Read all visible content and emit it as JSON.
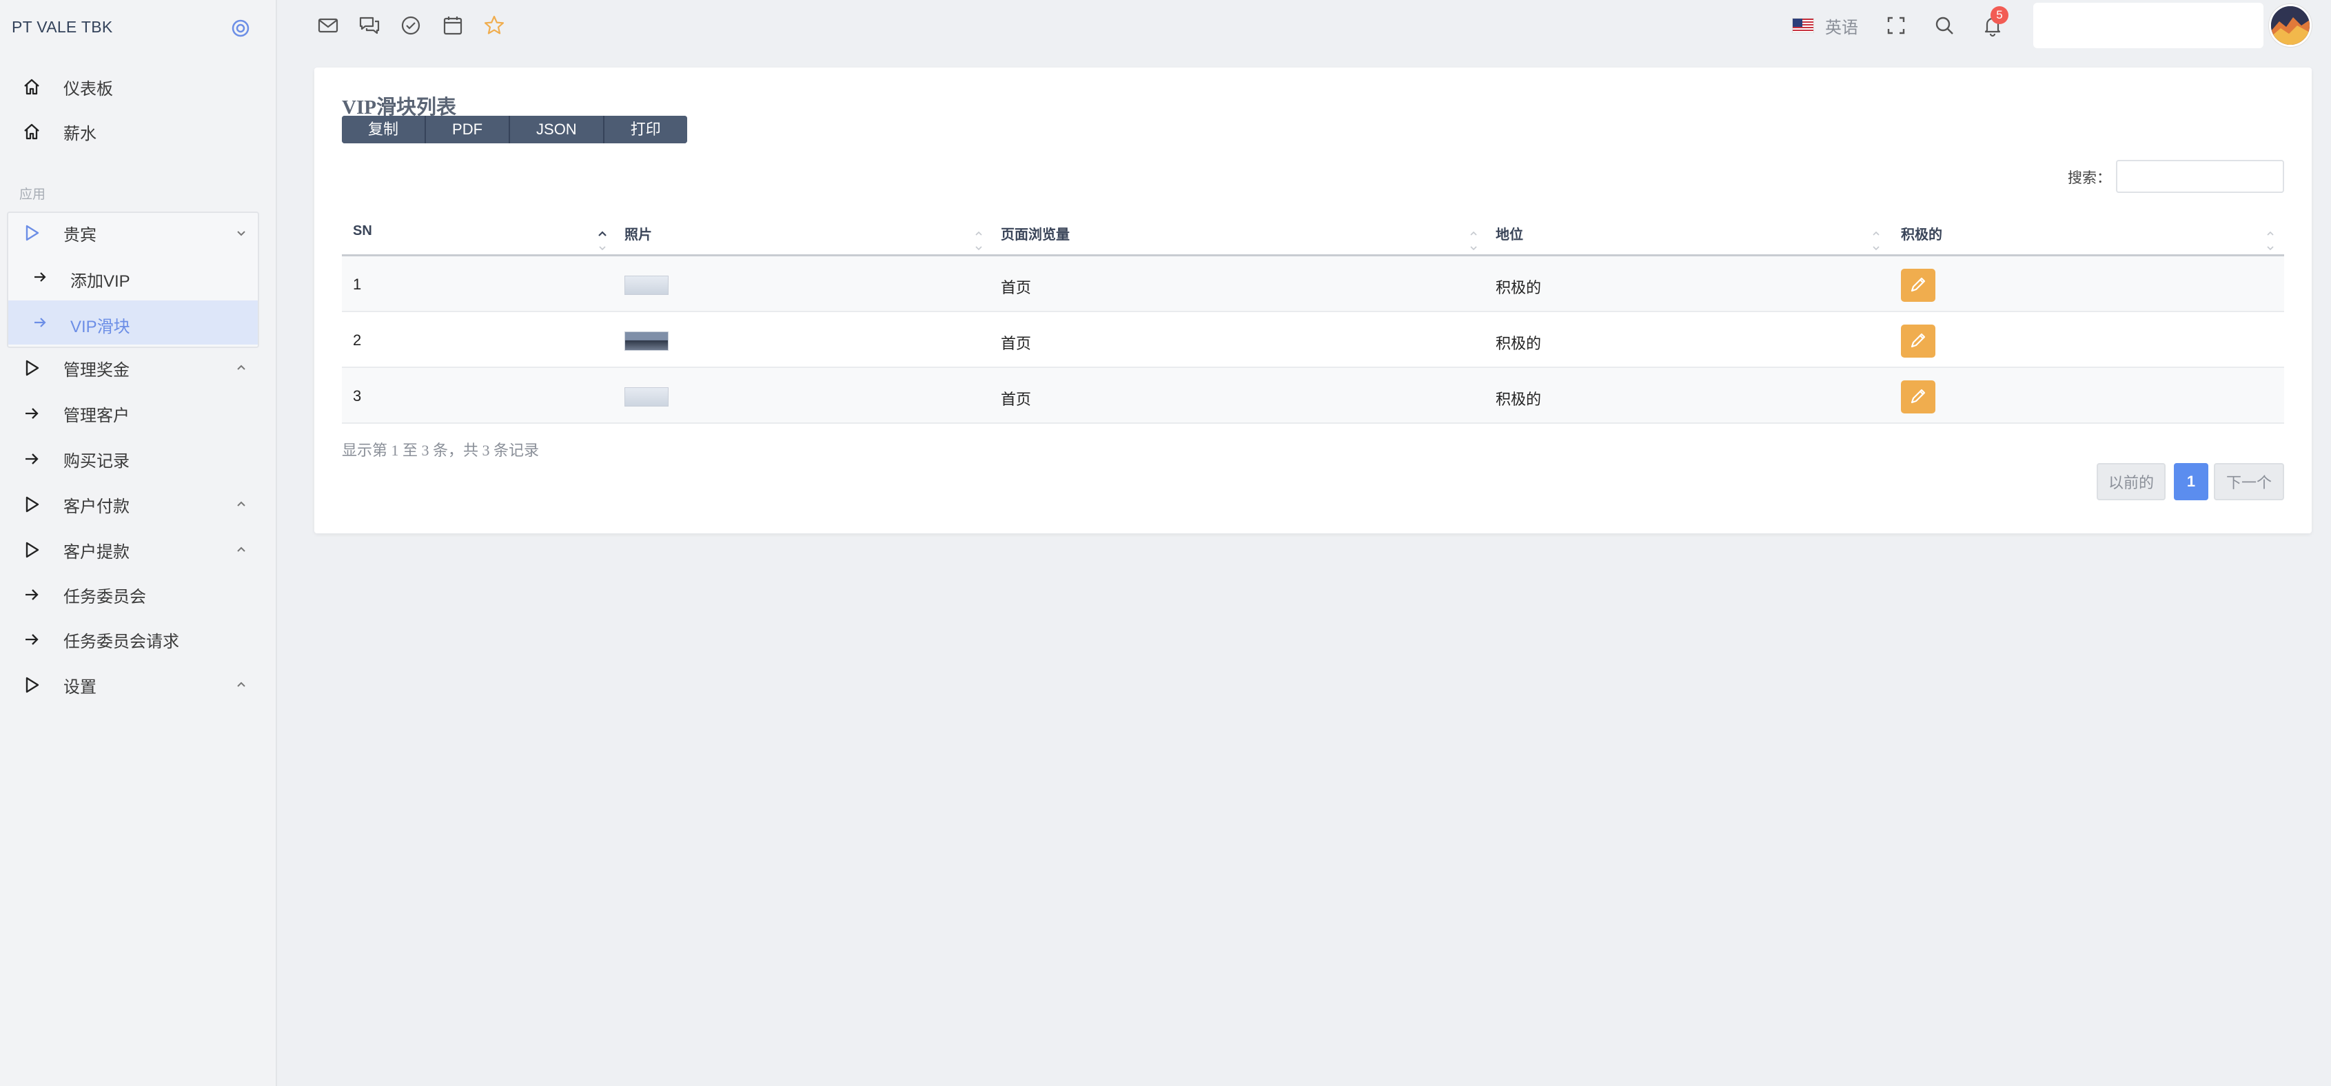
{
  "sidebar": {
    "brand": "PT VALE TBK",
    "top_items": [
      {
        "label": "仪表板",
        "icon": "home-icon"
      },
      {
        "label": "薪水",
        "icon": "home-icon"
      }
    ],
    "section_label": "应用",
    "items": [
      {
        "label": "贵宾",
        "icon": "play-icon",
        "caret": "chevron-down-icon"
      },
      {
        "label": "添加VIP",
        "icon": "arrow-right-icon"
      },
      {
        "label": "VIP滑块",
        "icon": "arrow-right-icon",
        "active": true
      },
      {
        "label": "管理奖金",
        "icon": "play-icon",
        "caret": "chevron-up-icon"
      },
      {
        "label": "管理客户",
        "icon": "arrow-right-icon"
      },
      {
        "label": "购买记录",
        "icon": "arrow-right-icon"
      },
      {
        "label": "客户付款",
        "icon": "play-icon",
        "caret": "chevron-up-icon"
      },
      {
        "label": "客户提款",
        "icon": "play-icon",
        "caret": "chevron-up-icon"
      },
      {
        "label": "任务委员会",
        "icon": "arrow-right-icon"
      },
      {
        "label": "任务委员会请求",
        "icon": "arrow-right-icon"
      },
      {
        "label": "设置",
        "icon": "play-icon",
        "caret": "chevron-up-icon"
      }
    ]
  },
  "topbar": {
    "icons": [
      "mail-icon",
      "chat-icon",
      "check-circle-icon",
      "calendar-icon",
      "star-icon"
    ],
    "language": "英语",
    "notification_count": "5"
  },
  "card": {
    "title": "VIP滑块列表",
    "buttons": [
      "复制",
      "PDF",
      "JSON",
      "打印"
    ],
    "search_label": "搜索：",
    "columns": [
      "SN",
      "照片",
      "页面浏览量",
      "地位",
      "积极的"
    ],
    "rows": [
      {
        "sn": "1",
        "page": "首页",
        "status": "积极的"
      },
      {
        "sn": "2",
        "page": "首页",
        "status": "积极的"
      },
      {
        "sn": "3",
        "page": "首页",
        "status": "积极的"
      }
    ],
    "info": "显示第 1 至 3 条，共 3 条记录",
    "pagination": {
      "prev": "以前的",
      "current": "1",
      "next": "下一个"
    }
  },
  "colors": {
    "accent": "#5b8def",
    "edit_button": "#f0ad4e",
    "badge": "#f25c54",
    "button_group": "#4d5c73",
    "active_bg": "#dde6f9"
  }
}
